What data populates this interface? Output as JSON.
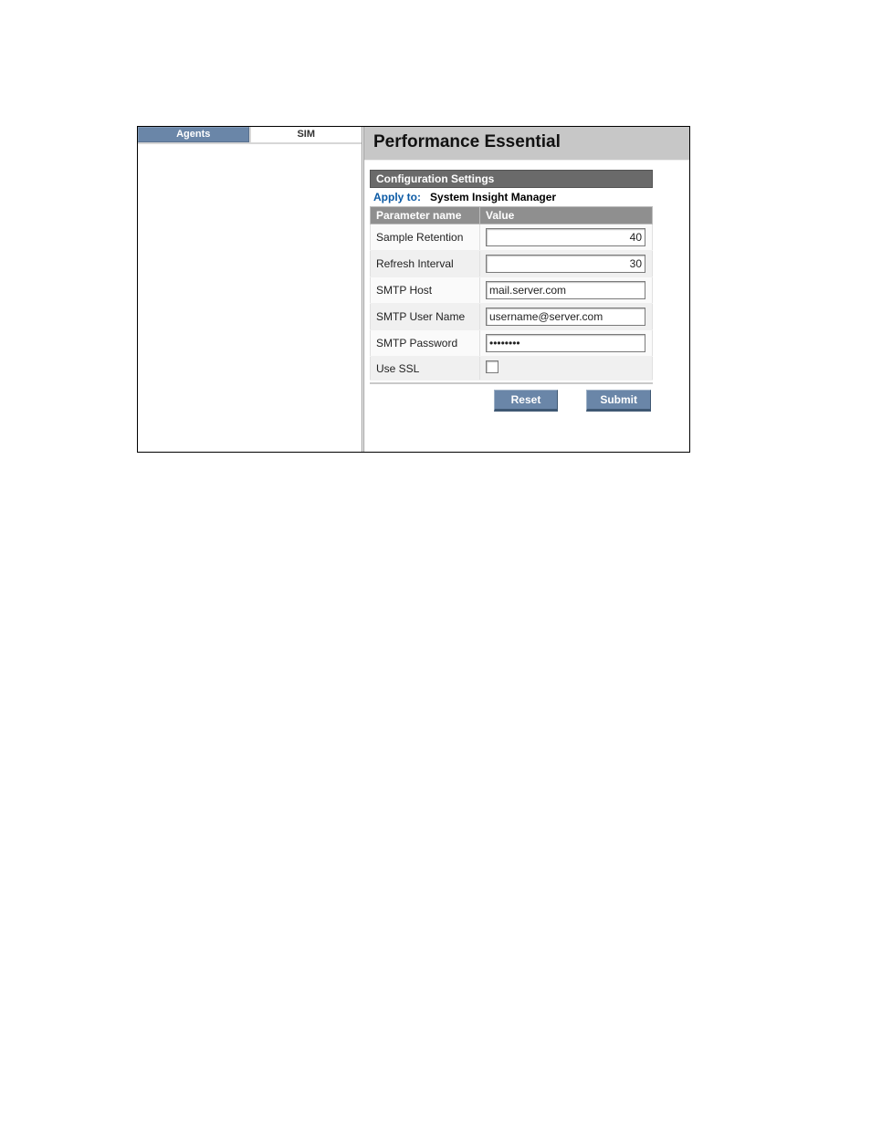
{
  "tabs": {
    "agents": "Agents",
    "sim": "SIM"
  },
  "page_title": "Performance Essential",
  "section_title": "Configuration Settings",
  "apply_to_label": "Apply to:",
  "apply_to_value": "System Insight Manager",
  "columns": {
    "param": "Parameter name",
    "value": "Value"
  },
  "params": {
    "sample_retention": {
      "label": "Sample Retention",
      "value": "40"
    },
    "refresh_interval": {
      "label": "Refresh Interval",
      "value": "30"
    },
    "smtp_host": {
      "label": "SMTP Host",
      "value": "mail.server.com"
    },
    "smtp_user": {
      "label": "SMTP User Name",
      "value": "username@server.com"
    },
    "smtp_password": {
      "label": "SMTP Password",
      "value": "••••••••"
    },
    "use_ssl": {
      "label": "Use SSL",
      "checked": false
    }
  },
  "buttons": {
    "reset": "Reset",
    "submit": "Submit"
  }
}
